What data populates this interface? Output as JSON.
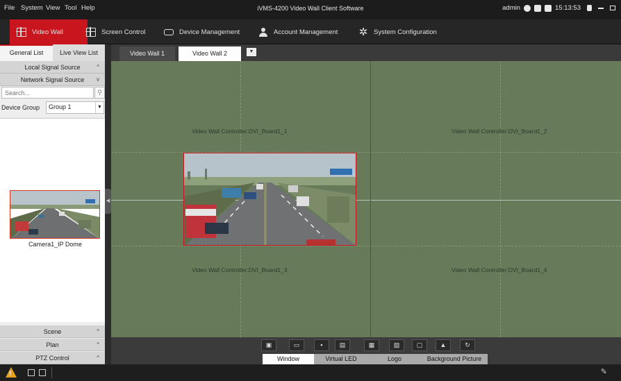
{
  "menu": [
    "File",
    "System",
    "View",
    "Tool",
    "Help"
  ],
  "app_title": "iVMS-4200 Video Wall Client Software",
  "title_right": {
    "user": "admin",
    "time": "15:13:53"
  },
  "modules": [
    {
      "label": "Video Wall",
      "icon": "video-wall-icon",
      "active": true
    },
    {
      "label": "Screen Control",
      "icon": "screen-control-icon"
    },
    {
      "label": "Device Management",
      "icon": "device-icon"
    },
    {
      "label": "Account Management",
      "icon": "user-icon"
    },
    {
      "label": "System Configuration",
      "icon": "gear-icon"
    }
  ],
  "left_panel": {
    "tabs": [
      "General List",
      "Live View List"
    ],
    "active_tab": "General List",
    "local_signal_source": "Local Signal Source",
    "network_signal_source": "Network Signal Source",
    "search_placeholder": "Search...",
    "device_group_label": "Device Group",
    "device_group_value": "Group 1",
    "camera_name": "Camera1_IP Dome",
    "bottom_sections": [
      "Scene",
      "Plan",
      "PTZ Control"
    ]
  },
  "wall_tabs": [
    "Video Wall 1",
    "Video Wall 2"
  ],
  "active_wall_tab": "Video Wall 2",
  "screens": [
    "Video Wall Controller:DVI_Board1_1",
    "Video Wall Controller:DVI_Board1_2",
    "Video Wall Controller:DVI_Board1_3",
    "Video Wall Controller:DVI_Board1_4"
  ],
  "bottom_tabs": [
    "Window",
    "Virtual LED",
    "Logo",
    "Background Picture"
  ],
  "active_bottom_tab": "Window",
  "colors": {
    "accent": "#c8151e",
    "wall": "#677a5a",
    "alarm": "#e8a020"
  }
}
